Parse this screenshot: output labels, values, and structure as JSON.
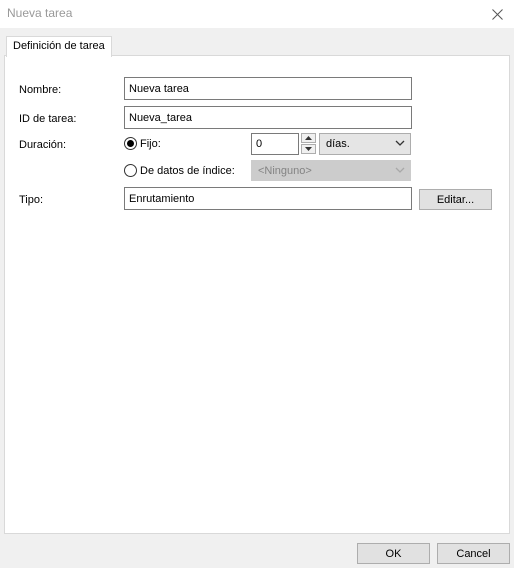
{
  "window": {
    "title": "Nueva tarea"
  },
  "tabs": [
    {
      "label": "Definición de tarea"
    }
  ],
  "form": {
    "name_label": "Nombre:",
    "name_value": "Nueva tarea",
    "id_label": "ID de tarea:",
    "id_value": "Nueva_tarea",
    "duration_label": "Duración:",
    "fixed_label": "Fijo:",
    "fixed_value": "0",
    "unit_value": "días.",
    "index_label": "De datos de índice:",
    "index_value": "<Ninguno>",
    "type_label": "Tipo:",
    "type_value": "Enrutamiento",
    "edit_label": "Editar..."
  },
  "footer": {
    "ok_label": "OK",
    "cancel_label": "Cancel"
  },
  "icons": {
    "close": "close-icon",
    "spin_up": "spin-up-icon",
    "spin_down": "spin-down-icon",
    "chevron": "chevron-down-icon"
  }
}
